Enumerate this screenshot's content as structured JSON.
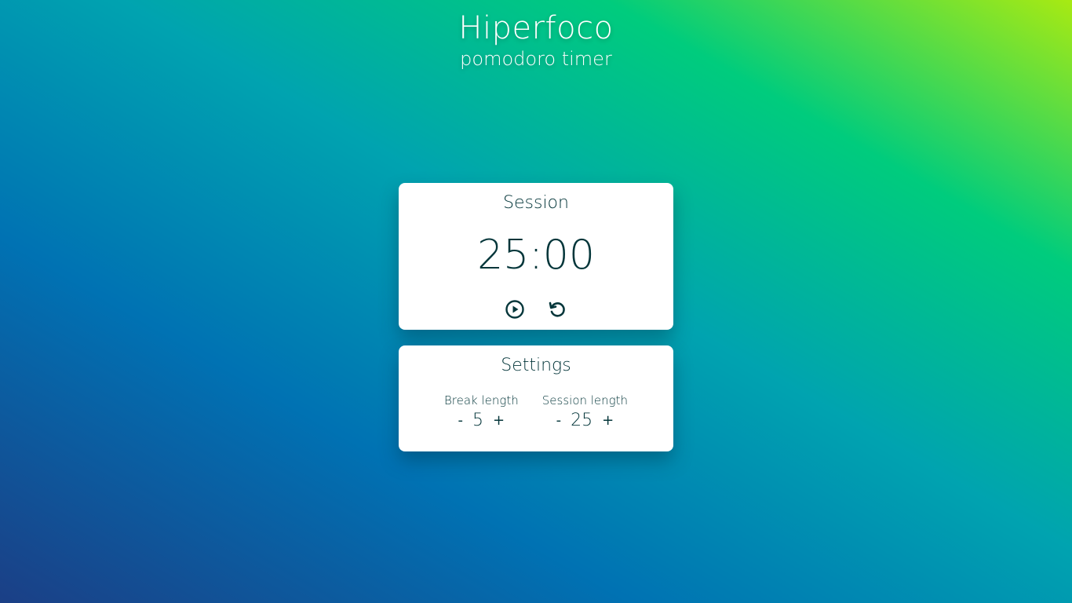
{
  "header": {
    "title": "Hiperfoco",
    "subtitle": "pomodoro timer"
  },
  "timer": {
    "label": "Session",
    "time": "25:00",
    "controls": {
      "start_icon": "play-circle-icon",
      "reset_icon": "reset-icon"
    }
  },
  "settings": {
    "title": "Settings",
    "break": {
      "label": "Break length",
      "decrement": "-",
      "value": "5",
      "increment": "+"
    },
    "session": {
      "label": "Session length",
      "decrement": "-",
      "value": "25",
      "increment": "+"
    }
  },
  "colors": {
    "text_dark": "#04363a",
    "card_bg": "#ffffff",
    "gradient": [
      "#1b3f86",
      "#0072b3",
      "#00a3b0",
      "#00cc7d",
      "#a8ea12"
    ]
  }
}
